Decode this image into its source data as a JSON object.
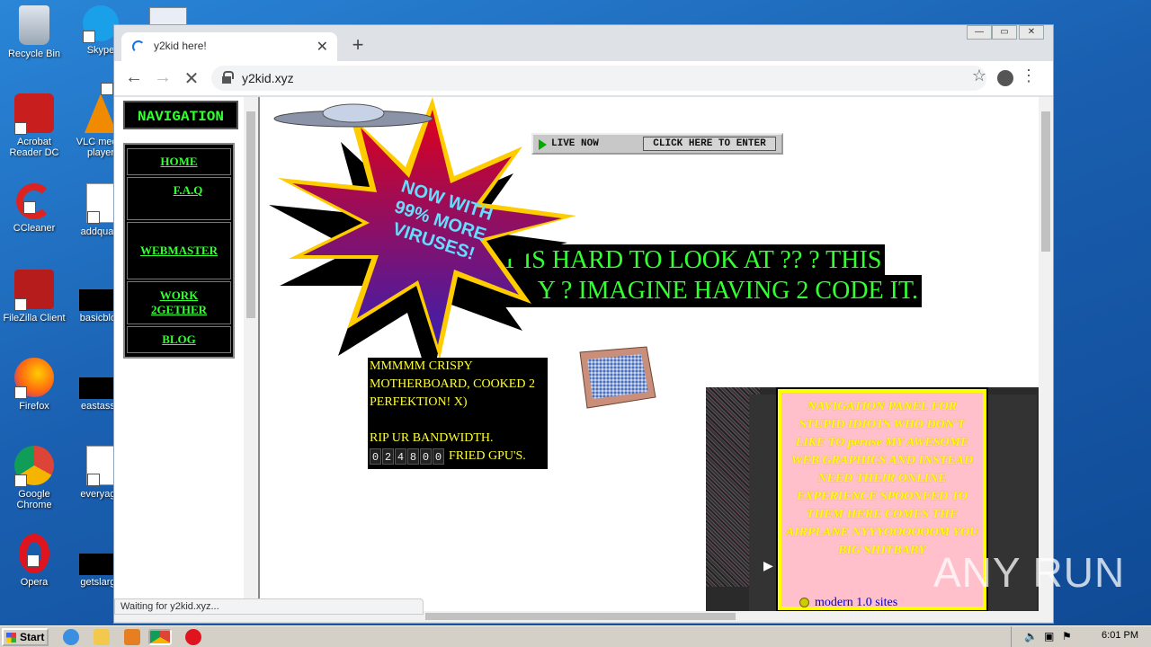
{
  "desktop": {
    "icons": [
      {
        "label": "Recycle Bin"
      },
      {
        "label": "Skype"
      },
      {
        "label": "Acrobat Reader DC"
      },
      {
        "label": "VLC media player"
      },
      {
        "label": "CCleaner"
      },
      {
        "label": "addqualit"
      },
      {
        "label": "FileZilla Client"
      },
      {
        "label": "basicblog"
      },
      {
        "label": "Firefox"
      },
      {
        "label": "eastasso"
      },
      {
        "label": "Google Chrome"
      },
      {
        "label": "everyaga"
      },
      {
        "label": "Opera"
      },
      {
        "label": "getslarge"
      }
    ]
  },
  "browser": {
    "tab_title": "y2kid here!",
    "url": "y2kid.xyz",
    "status": "Waiting for y2kid.xyz..."
  },
  "nav": {
    "title": "NAVIGATION",
    "items": [
      {
        "label": "HOME"
      },
      {
        "label": "F.A.Q"
      },
      {
        "label": "WEBMASTER"
      },
      {
        "label": "WORK 2GETHER"
      },
      {
        "label": "BLOG"
      }
    ]
  },
  "content": {
    "burst_text": "NOW WITH 99% MORE VIRUSES!",
    "live_label": "LIVE NOW",
    "enter_label": "CLICK HERE TO ENTER",
    "line1": "IT IS HARD TO LOOK AT ?? ? THIS",
    "line2": "Y ? IMAGINE HAVING 2 CODE IT.",
    "crispy_text": "MMMMM CRISPY MOTHERBOARD, COOKED 2 PERFEKTION! X)",
    "bandwidth_text": "RIP UR BANDWIDTH.",
    "counter_digits": [
      "0",
      "2",
      "4",
      "8",
      "0",
      "0"
    ],
    "fried_text": "FRIED GPU'S.",
    "panel_text": "NAVIGATION PANEL FOR STUPID IDIOTS WHO DON'T LIKE TO peruse MY AWESOME WEB GRAPHICS AND INSTEAD NEED THEIR ONLINE EXPERIENCE SPOONFED TO THEM HERE COMES THE AIRPLANE NYYYOOOOOOM YOU BIG SHITBABY",
    "modern_link": "modern 1.0 sites"
  },
  "watermark": "ANY RUN",
  "taskbar": {
    "start_label": "Start",
    "clock": "6:01 PM"
  }
}
